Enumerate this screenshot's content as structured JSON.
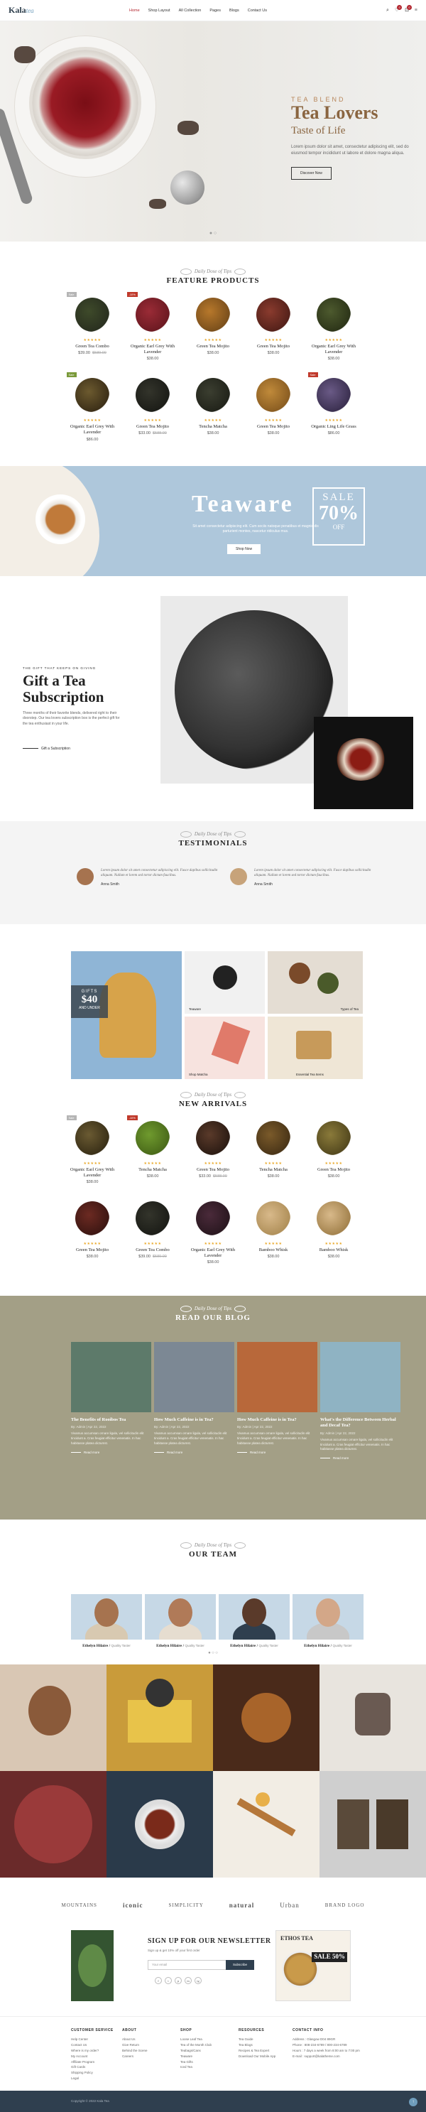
{
  "header": {
    "logo_main": "Kala",
    "logo_sub": "tea",
    "nav": [
      "Home",
      "Shop Layout",
      "All Collection",
      "Pages",
      "Blogs",
      "Contact Us"
    ],
    "cart_count": "0",
    "wishlist_count": "0"
  },
  "hero": {
    "kicker": "TEA BLEND",
    "title": "Tea Lovers",
    "subtitle": "Taste of Life",
    "text": "Lorem ipsum dolor sit amet, consectetur adipiscing elit, sed do eiusmod tempor incididunt ut labore et dolore magna aliqua.",
    "button": "Discover Now"
  },
  "featured": {
    "kicker": "Daily Dose of Tips",
    "title": "FEATURE PRODUCTS",
    "items": [
      {
        "name": "Green Tea Combo",
        "price": "$39.00",
        "old": "$589.00",
        "tag": "Sale",
        "tagc": "#b5b5b5",
        "c1": "#3e4a2a",
        "c2": "#2a3020"
      },
      {
        "name": "Organic Earl Grey With Lavender",
        "price": "$38.00",
        "tag": "-10%",
        "tagc": "#c0392b",
        "c1": "#9a2b36",
        "c2": "#6c1a22"
      },
      {
        "name": "Green Tea Mojito",
        "price": "$38.00",
        "old": "",
        "tag": "",
        "tagc": "",
        "c1": "#b7782b",
        "c2": "#7a4f1c"
      },
      {
        "name": "Green Tea Mojito",
        "price": "$38.00",
        "old": "",
        "tag": "",
        "tagc": "",
        "c1": "#8a3b2e",
        "c2": "#54211a"
      },
      {
        "name": "Organic Earl Grey With Lavender",
        "price": "$38.00",
        "old": "",
        "tag": "",
        "tagc": "",
        "c1": "#4d5a2e",
        "c2": "#2d3519"
      },
      {
        "name": "Organic Earl Grey With Lavender",
        "price": "$86.00",
        "old": "",
        "tag": "Sale",
        "tagc": "#7a9a3a",
        "c1": "#6c5a2f",
        "c2": "#3c2f18"
      },
      {
        "name": "Green Tea Mojito",
        "price": "$33.00",
        "old": "$588.00",
        "tag": "",
        "tagc": "",
        "c1": "#33342b",
        "c2": "#1c1d18"
      },
      {
        "name": "Tencha Matcha",
        "price": "$38.00",
        "old": "",
        "tag": "",
        "tagc": "",
        "c1": "#3b3e30",
        "c2": "#22241b"
      },
      {
        "name": "Green Tea Mojito",
        "price": "$38.00",
        "old": "",
        "tag": "",
        "tagc": "",
        "c1": "#c08a3a",
        "c2": "#8a5d22"
      },
      {
        "name": "Organic Ling Life Grass",
        "price": "$86.00",
        "old": "",
        "tag": "Sale",
        "tagc": "#c0392b",
        "c1": "#6a5a86",
        "c2": "#3b3050"
      }
    ]
  },
  "teaware": {
    "title": "Teaware",
    "text": "Sit amet consectetur adipiscing elit. Cum sociis natoque penatibus et magnis dis parturient montes, nascetur ridiculus mus.",
    "sale": "SALE",
    "percent": "70%",
    "off": "OFF",
    "button": "Shop Now"
  },
  "subscription": {
    "kicker": "THE GIFT THAT KEEPS ON GIVING",
    "title": "Gift a Tea Subscription",
    "text": "Three months of their favorite blends, delivered right to their doorstep. Our tea lovers subscription box is the perfect gift for the tea enthusiast in your life.",
    "link": "Gift a Subscription"
  },
  "testimonials": {
    "kicker": "Daily Dose of Tips",
    "title": "TESTIMONIALS",
    "items": [
      {
        "text": "Lorem ipsum dolor sit amet consectetur adipiscing elit. Fusce dapibus sollicitudin aliquam. Nullam et lorem sed tortor dictum faucibus.",
        "who": "Anna Smith"
      },
      {
        "text": "Lorem ipsum dolor sit amet consectetur adipiscing elit. Fusce dapibus sollicitudin aliquam. Nullam et lorem sed tortor dictum faucibus.",
        "who": "Anna Smith"
      }
    ]
  },
  "collections": {
    "gift": "GIFTS",
    "amount": "$40",
    "under": "AND UNDER",
    "tiles": [
      "Teaware",
      "Types of Tea",
      "Shop Matcha",
      "Essential Tea Items"
    ]
  },
  "arrivals": {
    "kicker": "Daily Dose of Tips",
    "title": "NEW ARRIVALS",
    "items": [
      {
        "name": "Organic Earl Grey With Lavender",
        "price": "$38.00",
        "old": "",
        "tag": "Sale",
        "tagc": "#b5b5b5",
        "c1": "#6a5a32",
        "c2": "#3a3018"
      },
      {
        "name": "Tencha Matcha",
        "price": "$38.00",
        "old": "",
        "tag": "-10%",
        "tagc": "#c0392b",
        "c1": "#6f9a2e",
        "c2": "#4a6a1a"
      },
      {
        "name": "Green Tea Mojito",
        "price": "$33.00",
        "old": "$588.00",
        "tag": "",
        "tagc": "",
        "c1": "#5a3a2a",
        "c2": "#2c1c14"
      },
      {
        "name": "Tencha Matcha",
        "price": "$38.00",
        "old": "",
        "tag": "",
        "tagc": "",
        "c1": "#7a5a2a",
        "c2": "#4a3518"
      },
      {
        "name": "Green Tea Mojito",
        "price": "$38.00",
        "old": "",
        "tag": "",
        "tagc": "",
        "c1": "#8a7a3a",
        "c2": "#54491f"
      },
      {
        "name": "Green Tea Mojito",
        "price": "$38.00",
        "old": "",
        "tag": "",
        "tagc": "",
        "c1": "#6c2a22",
        "c2": "#3d1713"
      },
      {
        "name": "Green Tea Combo",
        "price": "$39.00",
        "old": "$589.00",
        "tag": "",
        "tagc": "",
        "c1": "#33342b",
        "c2": "#1c1d18"
      },
      {
        "name": "Organic Earl Grey With Lavender",
        "price": "$38.00",
        "old": "",
        "tag": "",
        "tagc": "",
        "c1": "#4a2a3a",
        "c2": "#2a1820"
      },
      {
        "name": "Bamboo Whisk",
        "price": "$38.00",
        "old": "",
        "tag": "",
        "tagc": "",
        "c1": "#d8b98a",
        "c2": "#b0905a"
      },
      {
        "name": "Bamboo Whisk",
        "price": "$38.00",
        "old": "",
        "tag": "",
        "tagc": "",
        "c1": "#d8b98a",
        "c2": "#a3824d"
      }
    ]
  },
  "blog": {
    "kicker": "Daily Dose of Tips",
    "title": "READ OUR BLOG",
    "posts": [
      {
        "title": "The Benefits of Rooibos Tea",
        "meta": "By: Admin | Apr 22, 2022",
        "text": "Vivamus accumsan ornare ligula, vel sollicitudin elit tincidunt a. Cras feugiat efficitur venenatis. In hac habitasse platea dictumst.",
        "rm": "Read more",
        "c": "#5d7a6a"
      },
      {
        "title": "How Much Caffeine is in Tea?",
        "meta": "By: Admin | Apr 22, 2022",
        "text": "Vivamus accumsan ornare ligula, vel sollicitudin elit tincidunt a. Cras feugiat efficitur venenatis. In hac habitasse platea dictumst.",
        "rm": "Read more",
        "c": "#7c8894"
      },
      {
        "title": "How Much Caffeine is in Tea?",
        "meta": "By: Admin | Apr 22, 2022",
        "text": "Vivamus accumsan ornare ligula, vel sollicitudin elit tincidunt a. Cras feugiat efficitur venenatis. In hac habitasse platea dictumst.",
        "rm": "Read more",
        "c": "#b8683a"
      },
      {
        "title": "What's the Difference Between Herbal and Decaf Tea?",
        "meta": "By: Admin | Apr 22, 2022",
        "text": "Vivamus accumsan ornare ligula, vel sollicitudin elit tincidunt a. Cras feugiat efficitur venenatis. In hac habitasse platea dictumst.",
        "rm": "Read more",
        "c": "#8fb3c3"
      }
    ]
  },
  "team": {
    "kicker": "Daily Dose of Tips",
    "title": "OUR TEAM",
    "members": [
      {
        "name": "Ethelyn Hilaire",
        "role": "Quality Taster",
        "face": "#a6734f",
        "body": "#d8c9b1"
      },
      {
        "name": "Ethelyn Hilaire",
        "role": "Quality Taster",
        "face": "#b07a58",
        "body": "#e6ddd0"
      },
      {
        "name": "Ethelyn Hilaire",
        "role": "Quality Taster",
        "face": "#5a3a2a",
        "body": "#2f3f4f"
      },
      {
        "name": "Ethelyn Hilaire",
        "role": "Quality Taster",
        "face": "#d3a788",
        "body": "#c8c8c8"
      }
    ]
  },
  "brands": [
    "MOUNTAINS",
    "iconic",
    "SIMPLICITY",
    "natural",
    "Urban",
    "BRAND LOGO"
  ],
  "newsletter": {
    "title": "SIGN UP FOR OUR NEWSLETTER",
    "sub": "Sign up & get 10% off your first order",
    "placeholder": "Your email",
    "button": "Subscribe",
    "social": [
      "f",
      "t",
      "p",
      "in",
      "ig"
    ],
    "promo": "ETHOS TEA",
    "sale": "SALE 50%"
  },
  "footer": {
    "cols": [
      {
        "h": "CUSTOMER SERVICE",
        "items": [
          "Help Center",
          "Contact Us",
          "Where is my order?",
          "My Account",
          "Affiliate Program",
          "Gift Cards",
          "Shipping Policy",
          "Legal"
        ]
      },
      {
        "h": "ABOUT",
        "items": [
          "About Us",
          "Give Return",
          "Behind the Scene",
          "Careers"
        ]
      },
      {
        "h": "SHOP",
        "items": [
          "Loose Leaf Tea",
          "Tea of the Month Club",
          "Teabags/Cans",
          "Teaware",
          "Tea Gifts",
          "Iced Tea"
        ]
      },
      {
        "h": "RESOURCES",
        "items": [
          "Tea Guide",
          "Tea Blogs",
          "Recipes & Tea Expert",
          "Download Our Mobile App"
        ]
      },
      {
        "h": "CONTACT INFO",
        "items": [
          "Address : Glasgow D04 89GR",
          "Phone : 808-234-6789 / 800-234-6789",
          "Hours : 7 days a week from 8:00 am to 7:00 pm",
          "E-mail : support@kalatheme.com"
        ]
      }
    ],
    "copyright": "Copyright © 2022 Kala Tea"
  }
}
